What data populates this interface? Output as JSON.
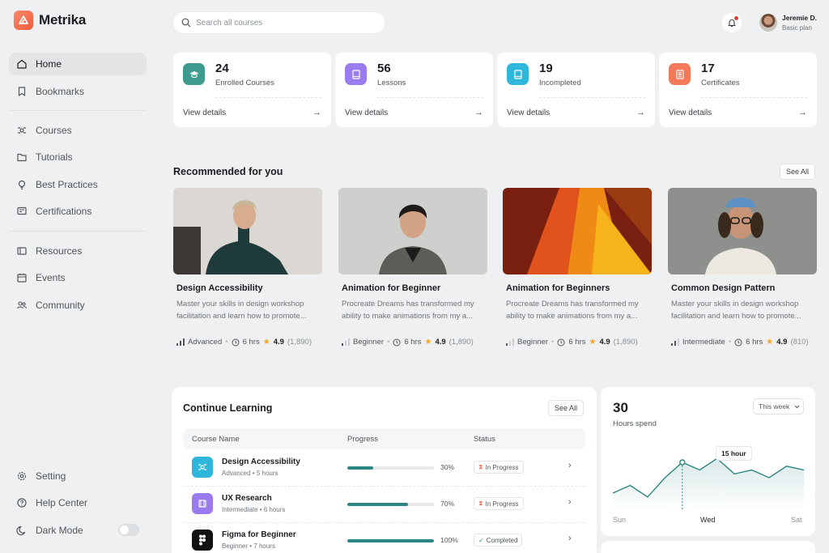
{
  "app": {
    "name": "Metrika"
  },
  "sidebar": {
    "items": [
      {
        "label": "Home"
      },
      {
        "label": "Bookmarks"
      },
      {
        "label": "Courses"
      },
      {
        "label": "Tutorials"
      },
      {
        "label": "Best Practices"
      },
      {
        "label": "Certifications"
      },
      {
        "label": "Resources"
      },
      {
        "label": "Events"
      },
      {
        "label": "Community"
      }
    ],
    "bottom": [
      {
        "label": "Setting"
      },
      {
        "label": "Help Center"
      },
      {
        "label": "Dark Mode"
      }
    ],
    "dark_mode_on": false
  },
  "header": {
    "search_placeholder": "Search all courses",
    "user_name": "Jeremie D.",
    "user_plan": "Basic plan"
  },
  "stats": [
    {
      "value": "24",
      "label": "Enrolled Courses",
      "link": "View details",
      "color": "#3f9b8e"
    },
    {
      "value": "56",
      "label": "Lessons",
      "link": "View details",
      "color": "#9a7cf0"
    },
    {
      "value": "19",
      "label": "Incompleted",
      "link": "View details",
      "color": "#2fb6db"
    },
    {
      "value": "17",
      "label": "Certificates",
      "link": "View details",
      "color": "#f2795a"
    }
  ],
  "recommended": {
    "title": "Recommended for you",
    "see_all": "See All",
    "courses": [
      {
        "title": "Design Accessibility",
        "desc": "Master your skills in design workshop facilitation and learn how to promote...",
        "level": "Advanced",
        "duration": "6 hrs",
        "rating": "4.9",
        "reviews": "(1,890)"
      },
      {
        "title": "Animation for Beginner",
        "desc": "Procreate Dreams has transformed my ability to make animations from my a...",
        "level": "Beginner",
        "duration": "6 hrs",
        "rating": "4.9",
        "reviews": "(1,890)"
      },
      {
        "title": "Animation for Beginners",
        "desc": "Procreate Dreams has transformed my ability to make animations from my a...",
        "level": "Beginner",
        "duration": "6 hrs",
        "rating": "4.9",
        "reviews": "(1,890)"
      },
      {
        "title": "Common Design Pattern",
        "desc": "Master your skills in design workshop facilitation and learn how to promote...",
        "level": "Intermediate",
        "duration": "6 hrs",
        "rating": "4.9",
        "reviews": "(810)"
      }
    ]
  },
  "continue": {
    "title": "Continue Learning",
    "see_all": "See All",
    "columns": [
      "Course Name",
      "Progress",
      "Status"
    ],
    "rows": [
      {
        "name": "Design Accessibility",
        "level": "Advanced",
        "hours": "5 hours",
        "progress": 0.3,
        "progress_label": "30%",
        "status": "In Progress",
        "icon_color": "#2fb6db"
      },
      {
        "name": "UX Research",
        "level": "Intermediate",
        "hours": "6 hours",
        "progress": 0.7,
        "progress_label": "70%",
        "status": "In Progress",
        "icon_color": "#9a7cf0"
      },
      {
        "name": "Figma for Beginner",
        "level": "Beginner",
        "hours": "7 hours",
        "progress": 1.0,
        "progress_label": "100%",
        "status": "Completed",
        "icon_color": "#111111"
      }
    ]
  },
  "hours": {
    "value": "30",
    "label": "Hours spend",
    "period": "This week",
    "tooltip": "15 hour",
    "x_labels": [
      "Sun",
      "Wed",
      "Sat"
    ],
    "series": [
      10,
      12,
      9,
      14,
      18,
      16,
      19,
      15,
      16,
      14,
      17,
      16
    ]
  }
}
